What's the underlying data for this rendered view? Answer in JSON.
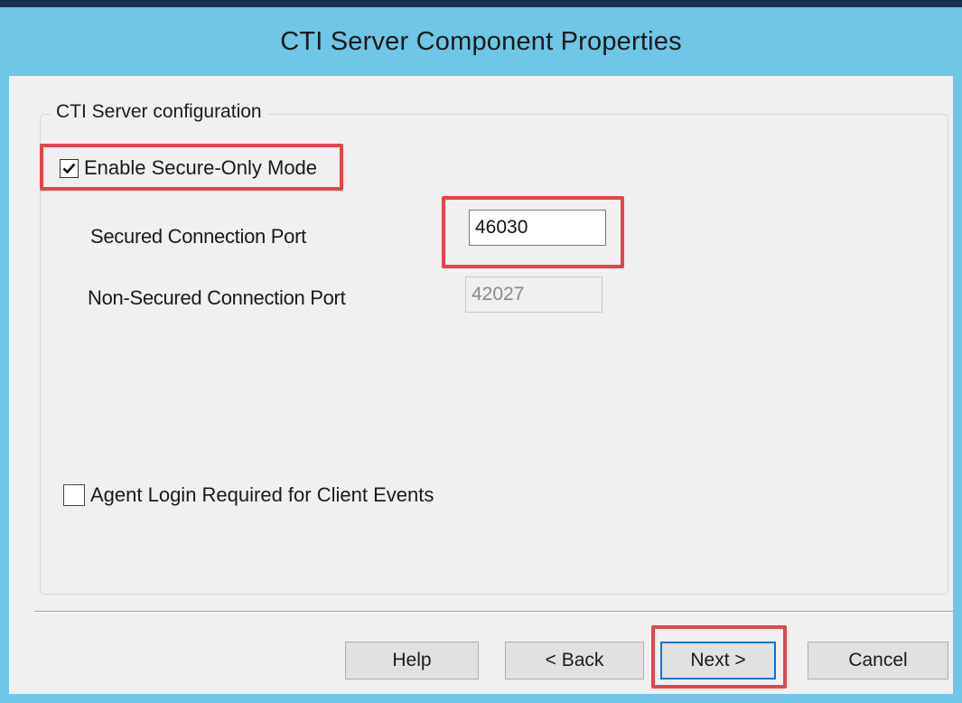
{
  "window": {
    "title": "CTI Server Component Properties"
  },
  "group": {
    "legend": "CTI Server configuration"
  },
  "secure_only": {
    "label": "Enable Secure-Only Mode",
    "checked": true
  },
  "secured_port": {
    "label": "Secured Connection Port",
    "value": "46030"
  },
  "non_secured_port": {
    "label": "Non-Secured Connection Port",
    "value": "42027",
    "disabled": true
  },
  "agent_login": {
    "label": "Agent Login Required for Client Events",
    "checked": false
  },
  "buttons": {
    "help": "Help",
    "back": "< Back",
    "next": "Next >",
    "cancel": "Cancel"
  },
  "colors": {
    "titlebar": "#6fc6e6",
    "highlight": "#e8424c",
    "dialog_bg": "#f0f0f0"
  }
}
